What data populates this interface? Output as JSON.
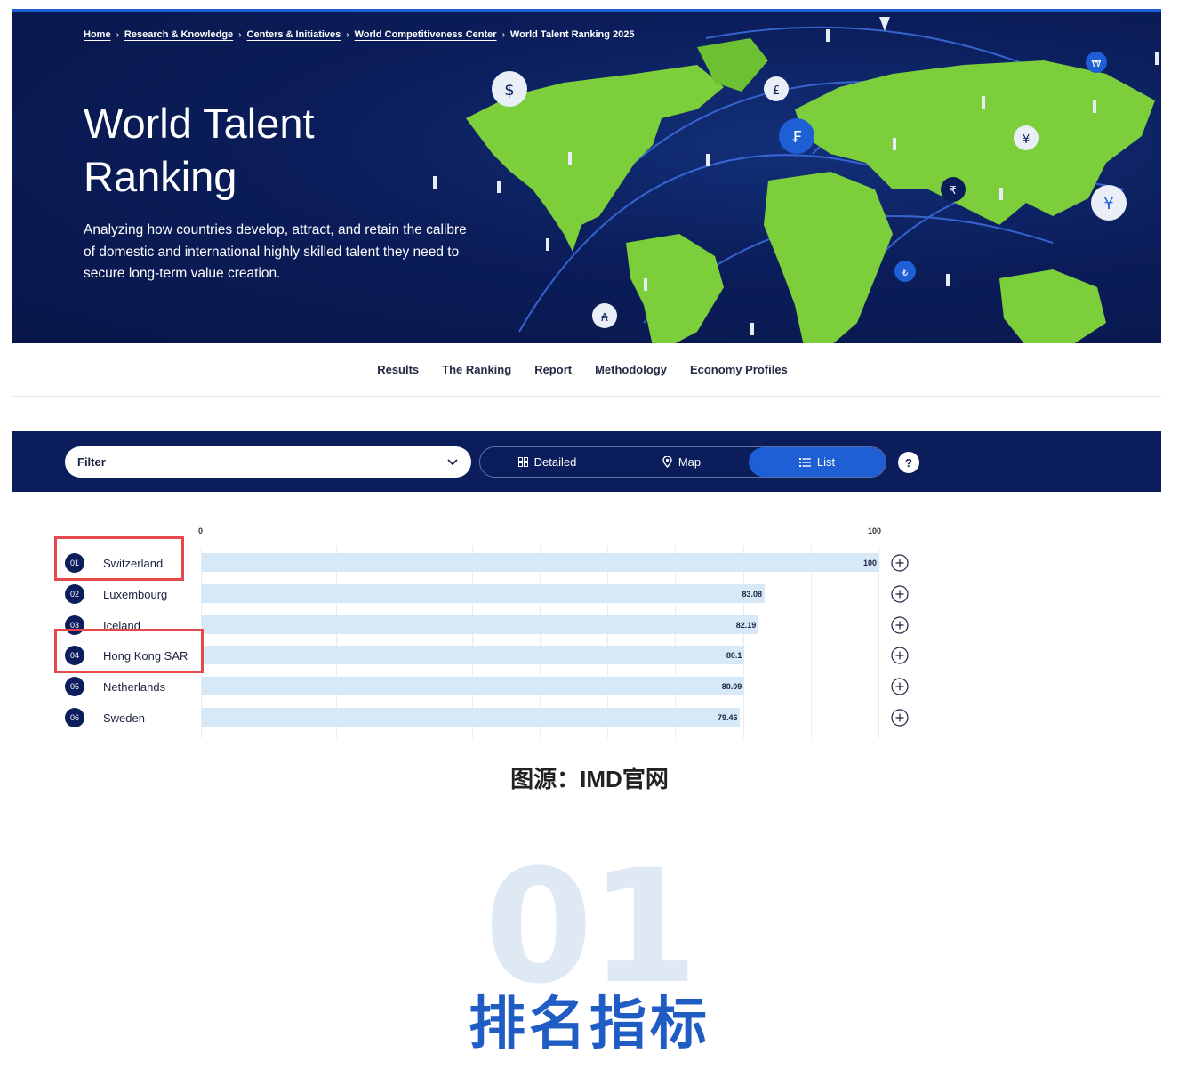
{
  "breadcrumb": [
    {
      "label": "Home"
    },
    {
      "label": "Research & Knowledge"
    },
    {
      "label": "Centers & Initiatives"
    },
    {
      "label": "World Competitiveness Center"
    },
    {
      "label": "World Talent Ranking 2025"
    }
  ],
  "hero": {
    "title_line1": "World Talent",
    "title_line2": "Ranking",
    "description": "Analyzing how countries develop, attract, and retain the calibre of domestic and international highly skilled talent they need to secure long-term value creation."
  },
  "nav": {
    "items": [
      "Results",
      "The Ranking",
      "Report",
      "Methodology",
      "Economy Profiles"
    ]
  },
  "toolbar": {
    "filter_label": "Filter",
    "views": [
      "Detailed",
      "Map",
      "List"
    ],
    "active_view": "List",
    "help_label": "?"
  },
  "chart_data": {
    "type": "bar",
    "orientation": "horizontal",
    "xlim": [
      0,
      100
    ],
    "tick_labels": [
      "0",
      "100"
    ],
    "ranks": [
      "01",
      "02",
      "03",
      "04",
      "05",
      "06"
    ],
    "categories": [
      "Switzerland",
      "Luxembourg",
      "Iceland",
      "Hong Kong SAR",
      "Netherlands",
      "Sweden"
    ],
    "values": [
      100,
      83.08,
      82.19,
      80.1,
      80.09,
      79.46
    ],
    "value_labels": [
      "100",
      "83.08",
      "82.19",
      "80.1",
      "80.09",
      "79.46"
    ],
    "highlighted": [
      "Switzerland",
      "Hong Kong SAR"
    ],
    "bar_color": "#d7e8f7",
    "highlight_color": "#e5484d"
  },
  "caption": "图源：IMD官网",
  "section": {
    "number": "01",
    "title": "排名指标"
  },
  "colors": {
    "navy": "#0b1d5a",
    "accent_blue": "#1e5fd6",
    "map_green": "#7ccf3a"
  }
}
